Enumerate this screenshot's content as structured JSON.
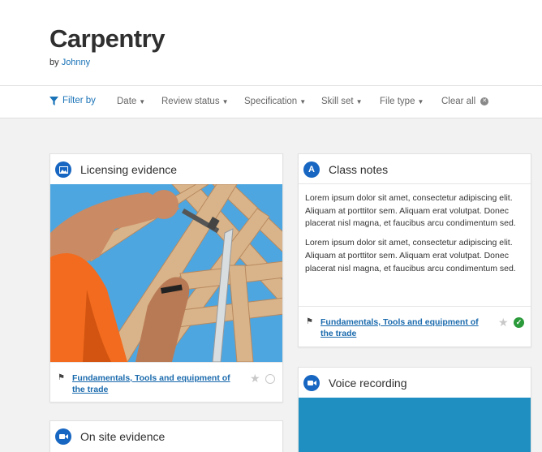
{
  "header": {
    "title": "Carpentry",
    "by_label": "by",
    "author": "Johnny"
  },
  "filters": {
    "filter_by": "Filter by",
    "items": [
      "Date",
      "Review status",
      "Specification",
      "Skill set",
      "File type"
    ],
    "clear_all": "Clear all"
  },
  "cards": {
    "licensing": {
      "title": "Licensing evidence",
      "icon": "image-icon",
      "skill": "Fundamentals, Tools and equipment of the trade",
      "status": "pending"
    },
    "class_notes": {
      "title": "Class notes",
      "icon_letter": "A",
      "paragraph1": "Lorem ipsum dolor sit amet, consectetur adipiscing elit. Aliquam at porttitor sem.  Aliquam erat volutpat. Donec placerat nisl magna, et faucibus arcu condimentum sed.",
      "paragraph2": "Lorem ipsum dolor sit amet, consectetur adipiscing elit. Aliquam at porttitor sem.  Aliquam erat volutpat. Donec placerat nisl magna, et faucibus arcu condimentum sed.",
      "skill": "Fundamentals, Tools and equipment of the trade",
      "status": "approved"
    },
    "voice": {
      "title": "Voice recording",
      "icon": "video-icon"
    },
    "onsite": {
      "title": "On site evidence",
      "icon": "video-icon"
    }
  },
  "colors": {
    "accent": "#1a73b8",
    "icon_bg": "#1766c2",
    "approved": "#2b9a3a",
    "voice_media": "#1e8fc0"
  }
}
